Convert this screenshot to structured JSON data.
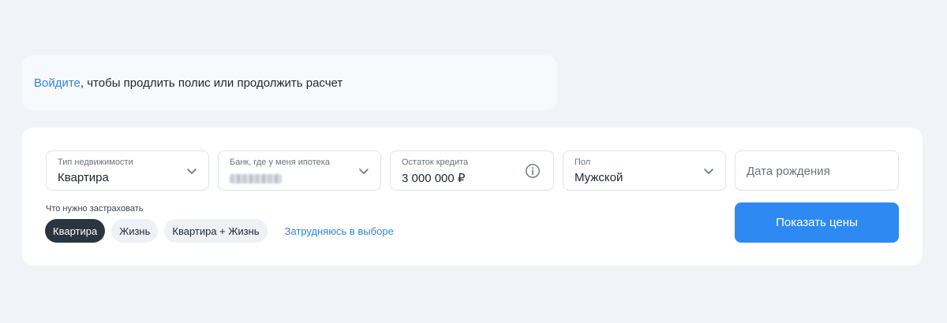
{
  "login_banner": {
    "link_text": "Войдите",
    "rest_text": ", чтобы продлить полис или продолжить расчет"
  },
  "form": {
    "property_type": {
      "label": "Тип недвижимости",
      "value": "Квартира",
      "icon": "chevron-down-icon"
    },
    "bank": {
      "label": "Банк, где у меня ипотека",
      "value_obscured": true,
      "icon": "chevron-down-icon"
    },
    "loan_balance": {
      "label": "Остаток кредита",
      "value": "3 000 000 ₽",
      "icon": "info-icon"
    },
    "gender": {
      "label": "Пол",
      "value": "Мужской",
      "icon": "chevron-down-icon"
    },
    "birth_date": {
      "placeholder": "Дата рождения"
    },
    "insure_label": "Что нужно застраховать",
    "insure_options": [
      {
        "label": "Квартира",
        "selected": true
      },
      {
        "label": "Жизнь",
        "selected": false
      },
      {
        "label": "Квартира + Жизнь",
        "selected": false
      }
    ],
    "help_link": "Затрудняюсь в выборе",
    "submit_label": "Показать цены"
  },
  "colors": {
    "accent": "#2f89f3",
    "link": "#2b86e8",
    "chip_active": "#2b3540",
    "background": "#f0f3f7"
  }
}
